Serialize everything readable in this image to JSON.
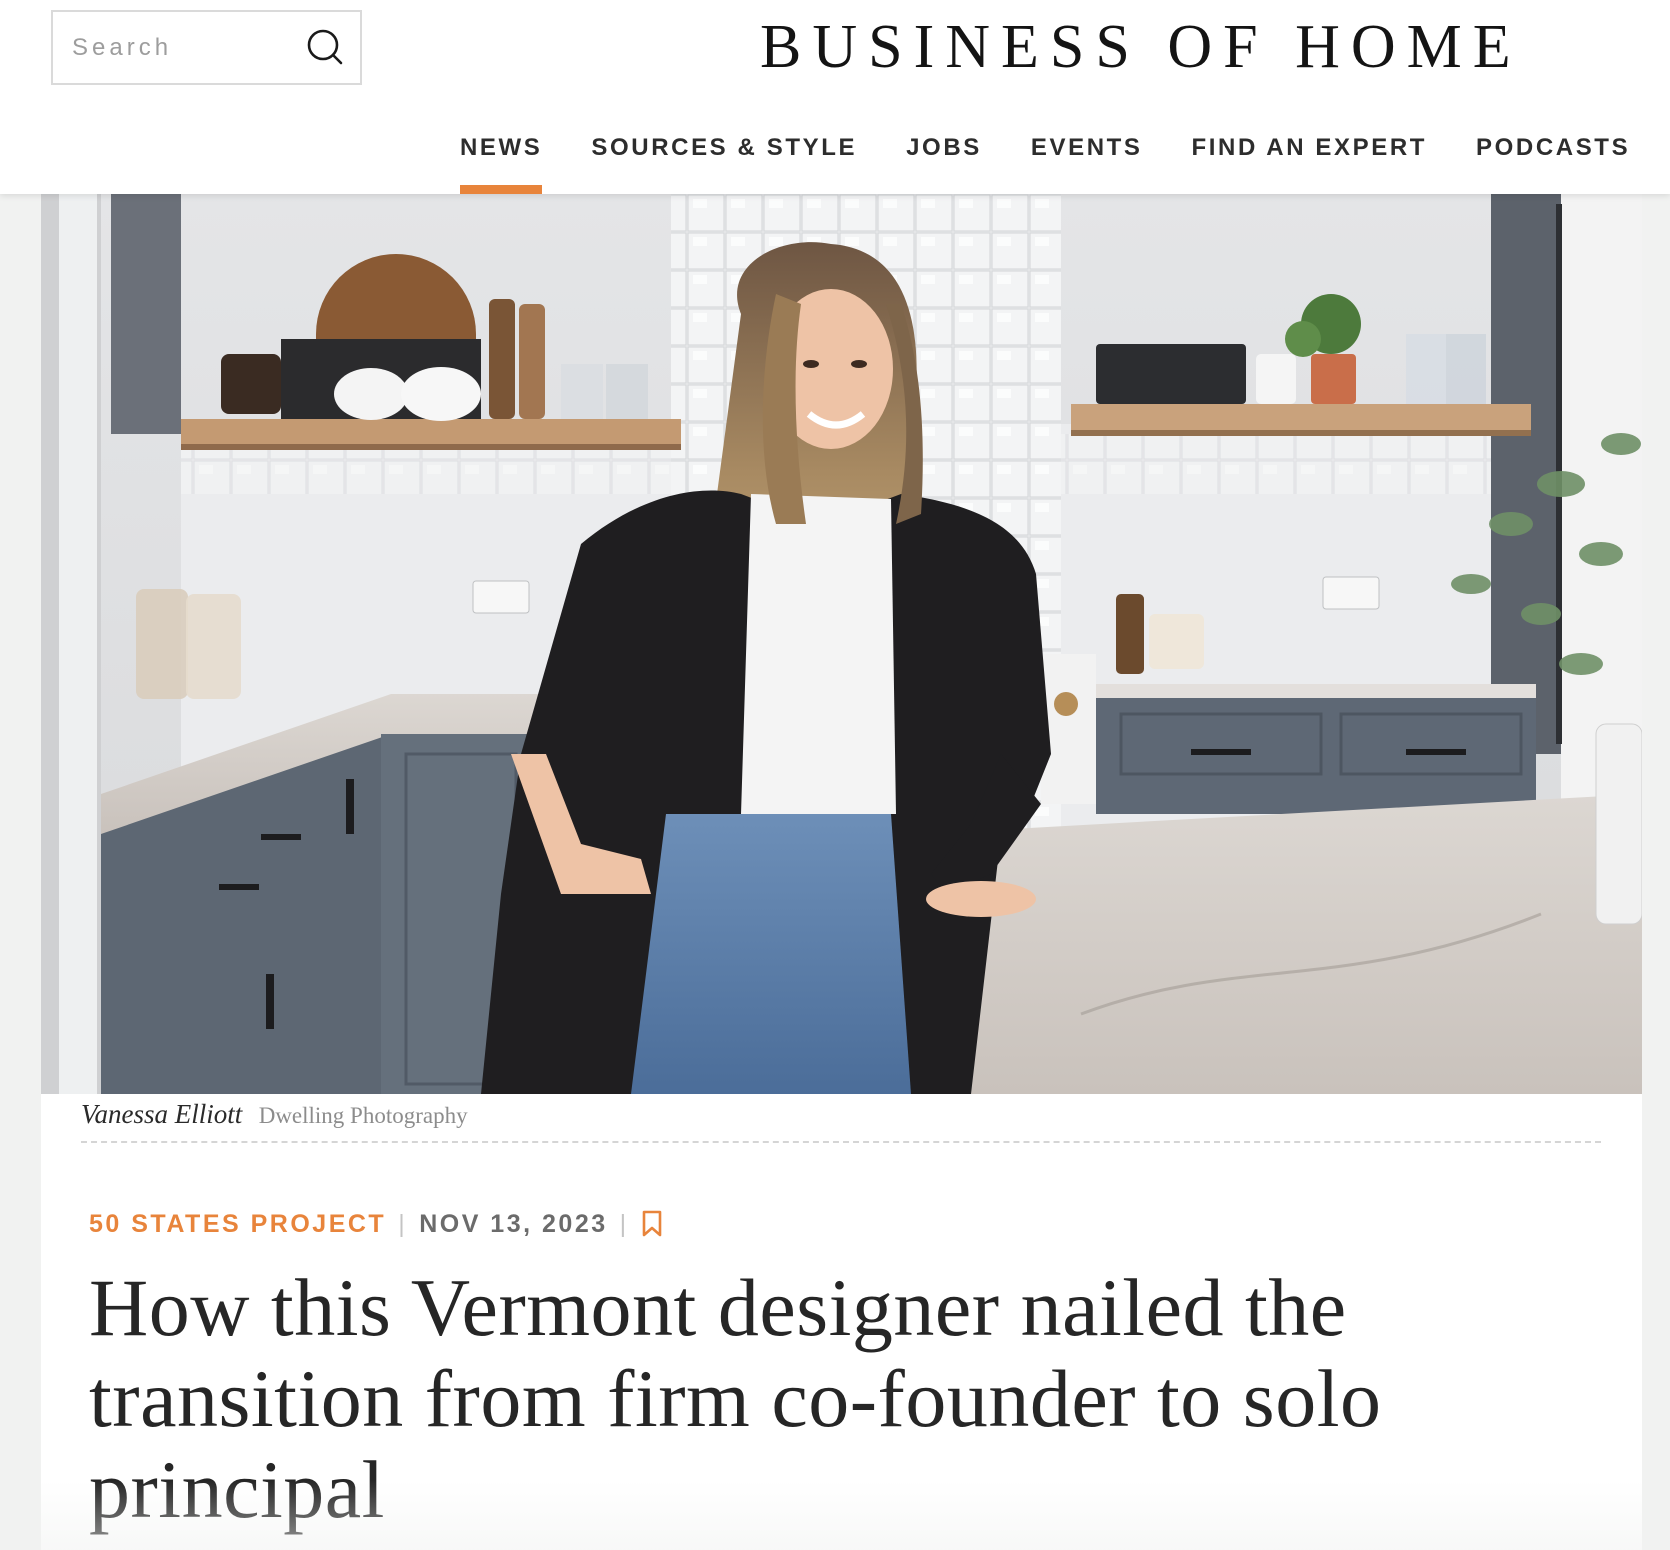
{
  "header": {
    "search": {
      "placeholder": "Search",
      "value": "",
      "icon": "search-icon"
    },
    "brand": "BUSINESS OF HOME",
    "nav": {
      "items": [
        {
          "label": "NEWS",
          "active": true
        },
        {
          "label": "SOURCES & STYLE",
          "active": false
        },
        {
          "label": "JOBS",
          "active": false
        },
        {
          "label": "EVENTS",
          "active": false
        },
        {
          "label": "FIND AN EXPERT",
          "active": false
        },
        {
          "label": "PODCASTS",
          "active": false
        }
      ]
    }
  },
  "article": {
    "hero": {
      "caption_name": "Vanessa Elliott",
      "caption_credit": "Dwelling Photography"
    },
    "meta": {
      "category": "50 STATES PROJECT",
      "separator": "|",
      "date": "NOV 13, 2023",
      "bookmark_icon": "bookmark-icon"
    },
    "headline": "How this Vermont designer nailed the transition from firm co-founder to solo principal"
  },
  "colors": {
    "accent": "#e8843b",
    "brand_text": "#141414",
    "page_bg": "#f1f2f1",
    "cabinet_gray": "#5d6773"
  }
}
